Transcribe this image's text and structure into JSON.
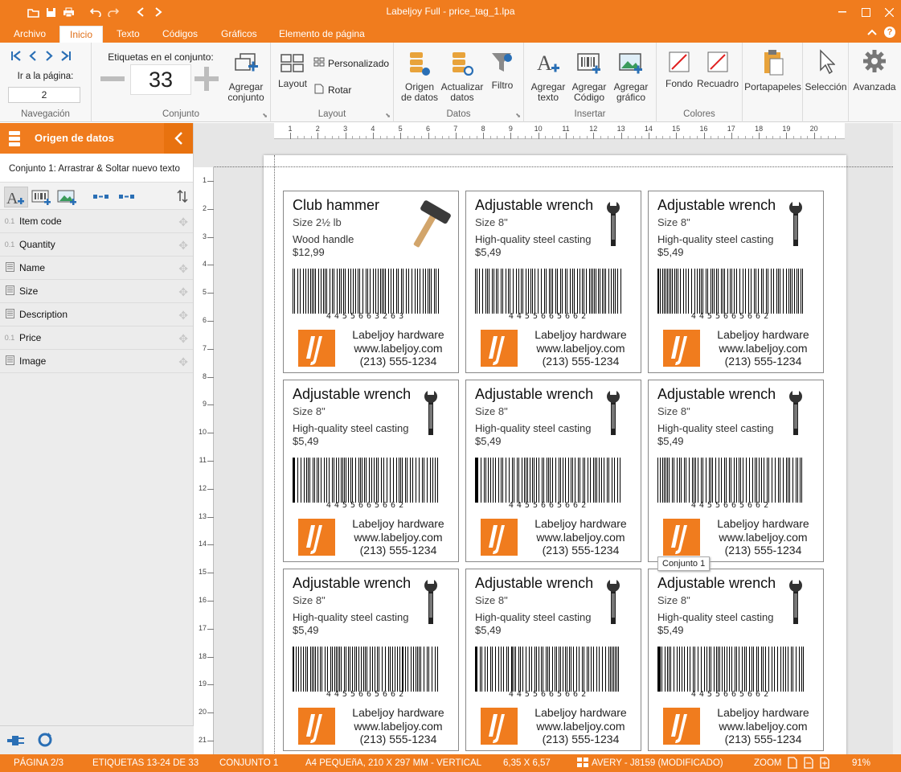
{
  "window": {
    "title": "Labeljoy Full - price_tag_1.lpa"
  },
  "tabs": [
    "Archivo",
    "Inicio",
    "Texto",
    "Códigos",
    "Gráficos",
    "Elemento de página"
  ],
  "ribbon": {
    "nav": {
      "goto_label": "Ir a la página:",
      "page_value": "2",
      "group_label": "Navegación"
    },
    "conjunto": {
      "labels_label": "Etiquetas en el conjunto:",
      "count": "33",
      "add_label": "Agregar conjunto",
      "group_label": "Conjunto"
    },
    "layout": {
      "layout_label": "Layout",
      "custom_label": "Personalizado",
      "rotate_label": "Rotar",
      "group_label": "Layout"
    },
    "datos": {
      "source_label": "Origen de datos",
      "refresh_label": "Actualizar datos",
      "filter_label": "Filtro",
      "group_label": "Datos"
    },
    "insertar": {
      "text_label": "Agregar texto",
      "code_label": "Agregar Código",
      "graphic_label": "Agregar gráfico",
      "group_label": "Insertar"
    },
    "colores": {
      "fill_label": "Fondo",
      "border_label": "Recuadro",
      "group_label": "Colores"
    },
    "clipboard_label": "Portapapeles",
    "selection_label": "Selección",
    "advanced_label": "Avanzada"
  },
  "sidebar": {
    "header": "Origen de datos",
    "conjunto_text": "Conjunto 1: Arrastrar & Soltar nuevo texto",
    "fields": [
      {
        "type": "0.1",
        "name": "Item code"
      },
      {
        "type": "0.1",
        "name": "Quantity"
      },
      {
        "type": "doc",
        "name": "Name"
      },
      {
        "type": "doc",
        "name": "Size"
      },
      {
        "type": "doc",
        "name": "Description"
      },
      {
        "type": "0.1",
        "name": "Price"
      },
      {
        "type": "doc",
        "name": "Image"
      }
    ]
  },
  "ruler": {
    "h": [
      "1",
      "2",
      "3",
      "4",
      "5",
      "6",
      "7",
      "8",
      "9",
      "10",
      "11",
      "12",
      "13",
      "14",
      "15",
      "16",
      "17",
      "18",
      "19",
      "20"
    ],
    "v": [
      "1",
      "2",
      "3",
      "4",
      "5",
      "6",
      "7",
      "8",
      "9",
      "10",
      "11",
      "12",
      "13",
      "14",
      "15",
      "16",
      "17",
      "18",
      "19",
      "20",
      "21"
    ]
  },
  "labels": [
    {
      "title": "Club hammer",
      "size": "Size 2½ lb",
      "desc": "Wood handle",
      "price": "$12,99",
      "barcode": "4455663263",
      "company": "Labeljoy hardware",
      "web": "www.labeljoy.com",
      "phone": "(213) 555-1234",
      "image": "hammer-icon"
    },
    {
      "title": "Adjustable wrench",
      "size": "Size 8\"",
      "desc": "High-quality steel casting",
      "price": "$5,49",
      "barcode": "4455665662",
      "company": "Labeljoy hardware",
      "web": "www.labeljoy.com",
      "phone": "(213) 555-1234",
      "image": "wrench-icon"
    },
    {
      "title": "Adjustable wrench",
      "size": "Size 8\"",
      "desc": "High-quality steel casting",
      "price": "$5,49",
      "barcode": "4455665662",
      "company": "Labeljoy hardware",
      "web": "www.labeljoy.com",
      "phone": "(213) 555-1234",
      "image": "wrench-icon"
    },
    {
      "title": "Adjustable wrench",
      "size": "Size 8\"",
      "desc": "High-quality steel casting",
      "price": "$5,49",
      "barcode": "4455665662",
      "company": "Labeljoy hardware",
      "web": "www.labeljoy.com",
      "phone": "(213) 555-1234",
      "image": "wrench-icon"
    },
    {
      "title": "Adjustable wrench",
      "size": "Size 8\"",
      "desc": "High-quality steel casting",
      "price": "$5,49",
      "barcode": "4455665662",
      "company": "Labeljoy hardware",
      "web": "www.labeljoy.com",
      "phone": "(213) 555-1234",
      "image": "wrench-icon"
    },
    {
      "title": "Adjustable wrench",
      "size": "Size 8\"",
      "desc": "High-quality steel casting",
      "price": "$5,49",
      "barcode": "4455665662",
      "company": "Labeljoy hardware",
      "web": "www.labeljoy.com",
      "phone": "(213) 555-1234",
      "image": "wrench-icon"
    },
    {
      "title": "Adjustable wrench",
      "size": "Size 8\"",
      "desc": "High-quality steel casting",
      "price": "$5,49",
      "barcode": "4455665662",
      "company": "Labeljoy hardware",
      "web": "www.labeljoy.com",
      "phone": "(213) 555-1234",
      "image": "wrench-icon"
    },
    {
      "title": "Adjustable wrench",
      "size": "Size 8\"",
      "desc": "High-quality steel casting",
      "price": "$5,49",
      "barcode": "4455665662",
      "company": "Labeljoy hardware",
      "web": "www.labeljoy.com",
      "phone": "(213) 555-1234",
      "image": "wrench-icon"
    },
    {
      "title": "Adjustable wrench",
      "size": "Size 8\"",
      "desc": "High-quality steel casting",
      "price": "$5,49",
      "barcode": "4455665662",
      "company": "Labeljoy hardware",
      "web": "www.labeljoy.com",
      "phone": "(213) 555-1234",
      "image": "wrench-icon"
    }
  ],
  "tooltip": "Conjunto 1",
  "status": {
    "page": "PÁGINA 2/3",
    "labels": "ETIQUETAS 13-24 DE 33",
    "set": "CONJUNTO 1",
    "paper": "A4 PEQUEñA, 210 X 297 MM - VERTICAL",
    "dims": "6,35 X 6,57",
    "template": "AVERY - J8159 (MODIFICADO)",
    "zoom_label": "ZOOM",
    "zoom": "91%"
  },
  "colors": {
    "accent": "#f07c1e"
  }
}
